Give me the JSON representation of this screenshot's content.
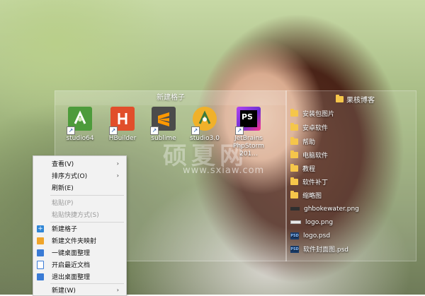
{
  "fence": {
    "title": "新建格子",
    "icons": [
      {
        "label": "studio64",
        "icon": "android-studio-icon",
        "color": "#4d9b3b"
      },
      {
        "label": "HBuilder",
        "icon": "hbuilder-icon",
        "color": "#e14e2b"
      },
      {
        "label": "sublime",
        "icon": "sublime-icon",
        "color": "#4b4b4b"
      },
      {
        "label": "studio3.0",
        "icon": "android-studio-icon",
        "color": "#f0b12a"
      },
      {
        "label": "JetBrains PhpStorm 201...",
        "icon": "phpstorm-icon",
        "color": "#7a3ec7"
      }
    ]
  },
  "right_fence": {
    "title": "果核博客",
    "items": [
      {
        "label": "安装包图片",
        "type": "folder"
      },
      {
        "label": "安卓软件",
        "type": "folder"
      },
      {
        "label": "帮助",
        "type": "folder"
      },
      {
        "label": "电脑软件",
        "type": "folder"
      },
      {
        "label": "教程",
        "type": "folder"
      },
      {
        "label": "软件补丁",
        "type": "folder"
      },
      {
        "label": "缩略图",
        "type": "folder"
      },
      {
        "label": "ghbokewater.png",
        "type": "png-dark"
      },
      {
        "label": "logo.png",
        "type": "png-light"
      },
      {
        "label": "logo.psd",
        "type": "psd"
      },
      {
        "label": "软件封面图.psd",
        "type": "psd"
      }
    ]
  },
  "context_menu": {
    "items": [
      {
        "label": "查看(V)",
        "submenu": true,
        "disabled": false
      },
      {
        "label": "排序方式(O)",
        "submenu": true,
        "disabled": false
      },
      {
        "label": "刷新(E)",
        "submenu": false,
        "disabled": false
      },
      {
        "separator": true
      },
      {
        "label": "粘贴(P)",
        "submenu": false,
        "disabled": true
      },
      {
        "label": "粘贴快捷方式(S)",
        "submenu": false,
        "disabled": true
      },
      {
        "separator": true
      },
      {
        "label": "新建格子",
        "icon": "plus-icon",
        "icon_color": "#2f86d6"
      },
      {
        "label": "新建文件夹映射",
        "icon": "folder-map-icon",
        "icon_color": "#f0a52a"
      },
      {
        "label": "一键桌面整理",
        "icon": "organize-icon",
        "icon_color": "#3a7bd5"
      },
      {
        "label": "开启最近文档",
        "icon": "document-icon",
        "icon_color": "#3a7bd5"
      },
      {
        "label": "退出桌面整理",
        "icon": "exit-icon",
        "icon_color": "#3a7bd5"
      },
      {
        "separator": true
      },
      {
        "label": "新建(W)",
        "submenu": true,
        "disabled": false
      }
    ]
  },
  "watermark": {
    "text": "硕夏网",
    "url": "www.sxiaw.com"
  }
}
